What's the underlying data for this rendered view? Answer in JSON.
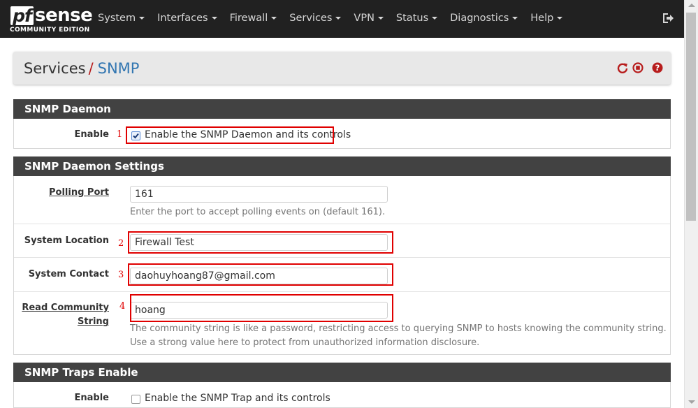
{
  "navbar": {
    "logo_pf": "pf",
    "logo_sense": "sense",
    "logo_edition": "COMMUNITY EDITION",
    "menu": [
      "System",
      "Interfaces",
      "Firewall",
      "Services",
      "VPN",
      "Status",
      "Diagnostics",
      "Help"
    ]
  },
  "breadcrumb": {
    "parent": "Services",
    "separator": "/",
    "current": "SNMP",
    "icons": [
      "restart-icon",
      "stop-icon",
      "help-icon"
    ]
  },
  "snmp_daemon": {
    "title": "SNMP Daemon",
    "enable_label": "Enable",
    "enable_marker": "1",
    "enable_checked": true,
    "enable_text": "Enable the SNMP Daemon and its controls"
  },
  "daemon_settings": {
    "title": "SNMP Daemon Settings",
    "polling_port_label": "Polling Port",
    "polling_port_value": "161",
    "polling_port_help": "Enter the port to accept polling events on (default 161).",
    "system_location_label": "System Location",
    "system_location_marker": "2",
    "system_location_value": "Firewall Test",
    "system_contact_label": "System Contact",
    "system_contact_marker": "3",
    "system_contact_value": "daohuyhoang87@gmail.com",
    "read_community_label_1": "Read Community",
    "read_community_label_2": "String",
    "read_community_marker": "4",
    "read_community_value": "hoang",
    "read_community_help": "The community string is like a password, restricting access to querying SNMP to hosts knowing the community string. Use a strong value here to protect from unauthorized information disclosure."
  },
  "traps": {
    "title": "SNMP Traps Enable",
    "enable_label": "Enable",
    "enable_checked": false,
    "enable_text": "Enable the SNMP Trap and its controls"
  },
  "colors": {
    "navbar": "#212121",
    "panel_header": "#424242",
    "accent_blue": "#3276b1",
    "accent_red": "#b71c1c",
    "annotation_red": "#e00000"
  }
}
